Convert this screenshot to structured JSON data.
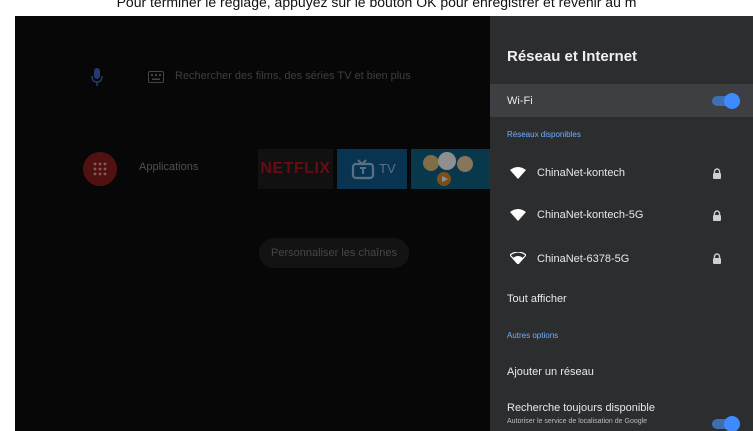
{
  "caption": "Pour terminer le réglage, appuyez sur le bouton OK pour enregistrer et revenir au m",
  "home": {
    "search_hint": "Rechercher des films, des séries TV et bien plus",
    "apps_label": "Applications",
    "netflix_label": "NETFLIX",
    "tv_label": "TV",
    "channels_button": "Personnaliser les chaînes"
  },
  "panel": {
    "title": "Réseau et Internet",
    "wifi_label": "Wi-Fi",
    "wifi_enabled": true,
    "section_available": "Réseaux disponibles",
    "networks": [
      {
        "ssid": "ChinaNet-kontech",
        "secured": true
      },
      {
        "ssid": "ChinaNet-kontech-5G",
        "secured": true
      },
      {
        "ssid": "ChinaNet-6378-5G",
        "secured": true
      }
    ],
    "show_all": "Tout afficher",
    "section_other": "Autres options",
    "add_network": "Ajouter un réseau",
    "scanning_title": "Recherche toujours disponible",
    "scanning_subtitle": "Autoriser le service de localisation de Google",
    "scanning_enabled": true
  },
  "colors": {
    "accent": "#3d8bff",
    "section_text": "#6fb0ff",
    "panel_bg": "#2c2d2f",
    "highlight_row": "#3d3f42"
  }
}
